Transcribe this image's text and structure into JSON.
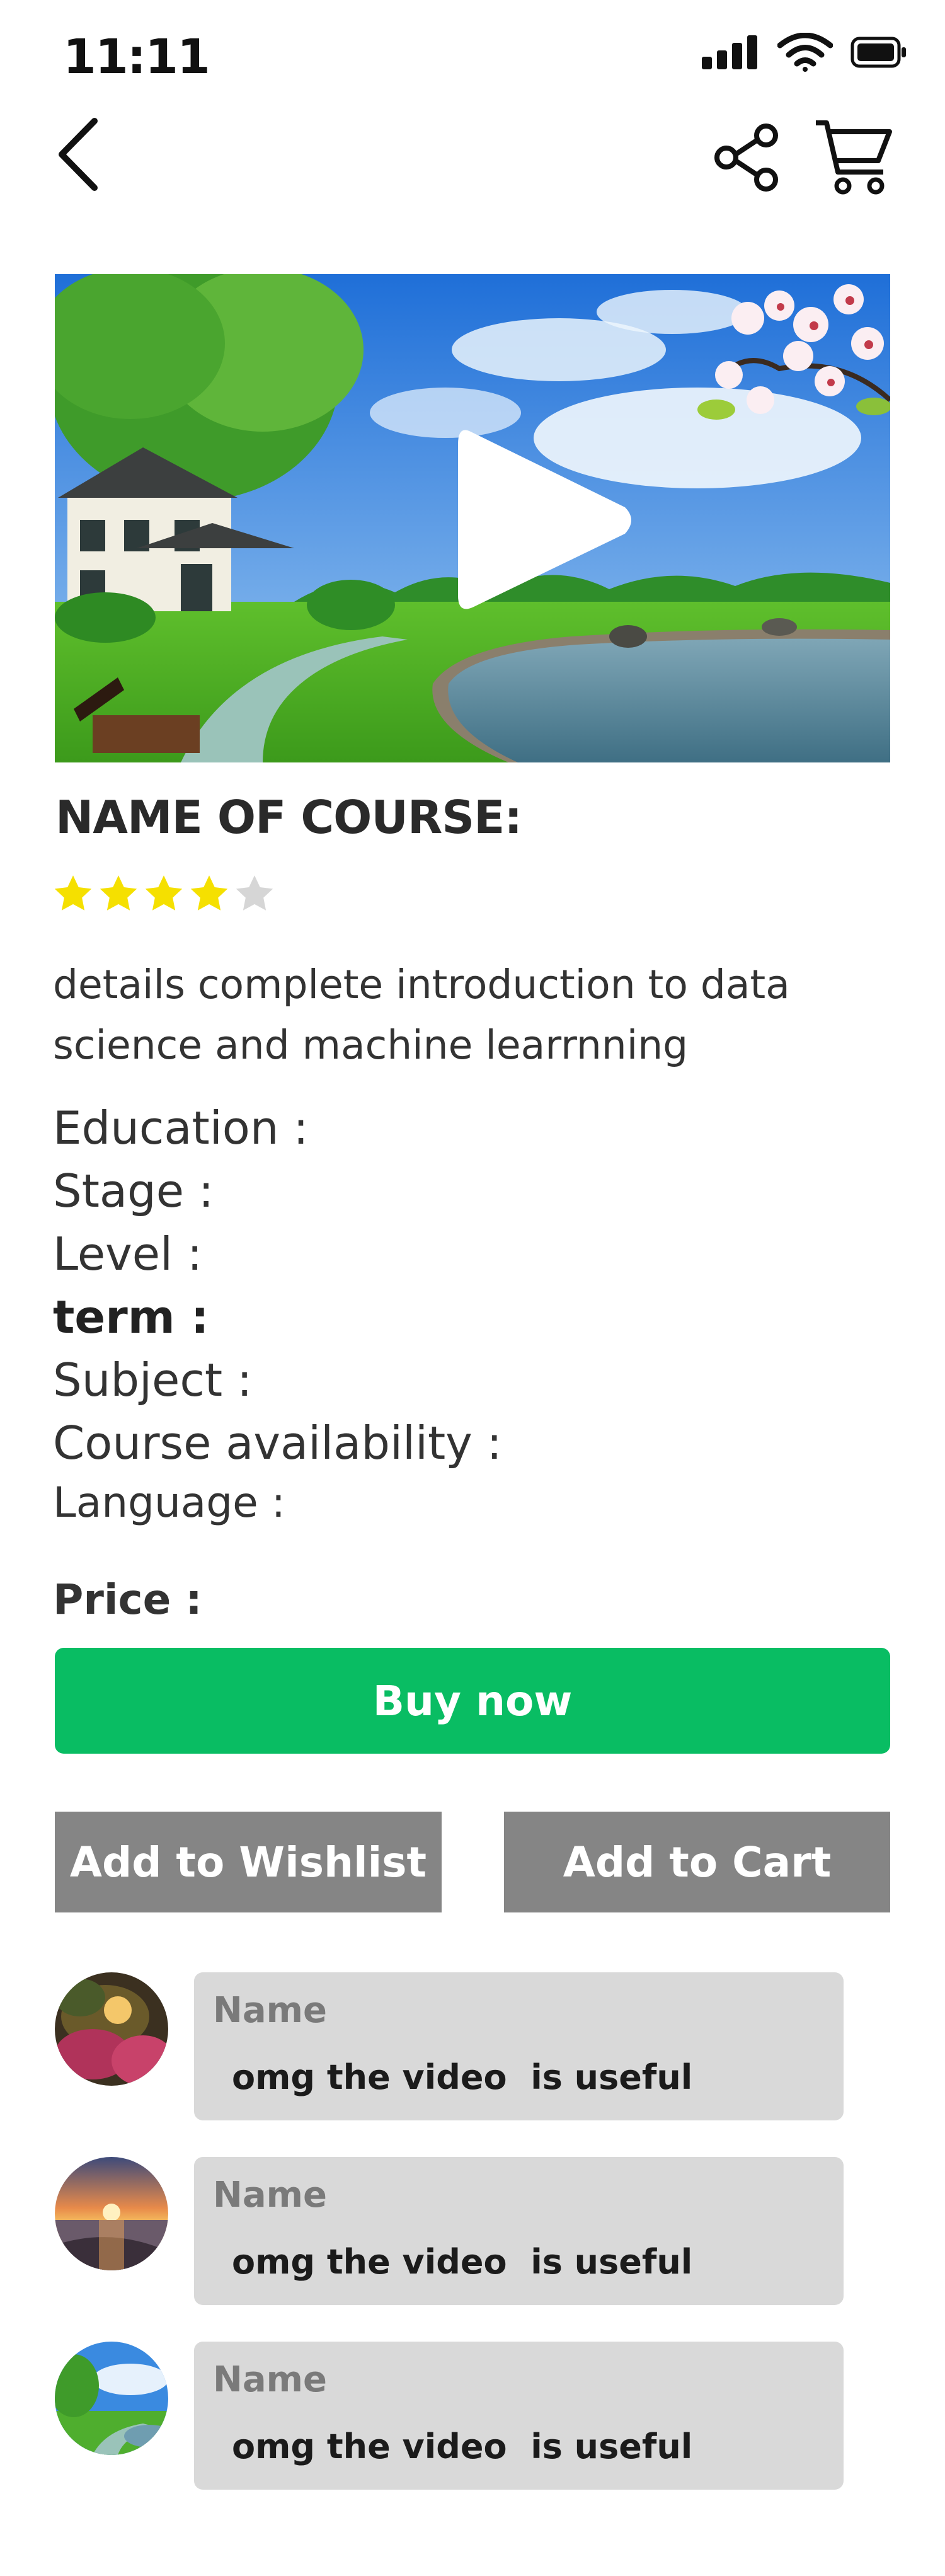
{
  "status_bar": {
    "time": "11:11",
    "icons": [
      "signal-icon",
      "wifi-icon",
      "battery-icon"
    ]
  },
  "nav": {
    "back_icon": "back-chevron-icon",
    "share_icon": "share-icon",
    "cart_icon": "cart-icon"
  },
  "video": {
    "thumbnail": "landscape with house, path, lake and blossoms",
    "play_icon": "play-icon"
  },
  "course": {
    "title": "NAME OF COURSE:",
    "rating": 4,
    "rating_max": 5,
    "description": "details complete introduction to data science and machine learrnning"
  },
  "fields": {
    "education": "Education :",
    "stage": "Stage :",
    "level": "Level :",
    "term": "term :",
    "subject": "Subject :",
    "availability": "Course availability :",
    "language": "Language :"
  },
  "price_label": "Price :",
  "buttons": {
    "buy_now": "Buy now",
    "add_to_wishlist": "Add to Wishlist",
    "add_to_cart": "Add to Cart"
  },
  "comments": [
    {
      "name": "Name",
      "text": "omg the video  is useful"
    },
    {
      "name": "Name",
      "text": "omg the video  is useful"
    },
    {
      "name": "Name",
      "text": "omg the video  is useful"
    }
  ],
  "colors": {
    "buy_button": "#09bd63",
    "secondary_button": "#858585",
    "comment_bubble": "#d9d9d9",
    "star_filled": "#f5e000",
    "star_empty": "#d6d6d6"
  }
}
